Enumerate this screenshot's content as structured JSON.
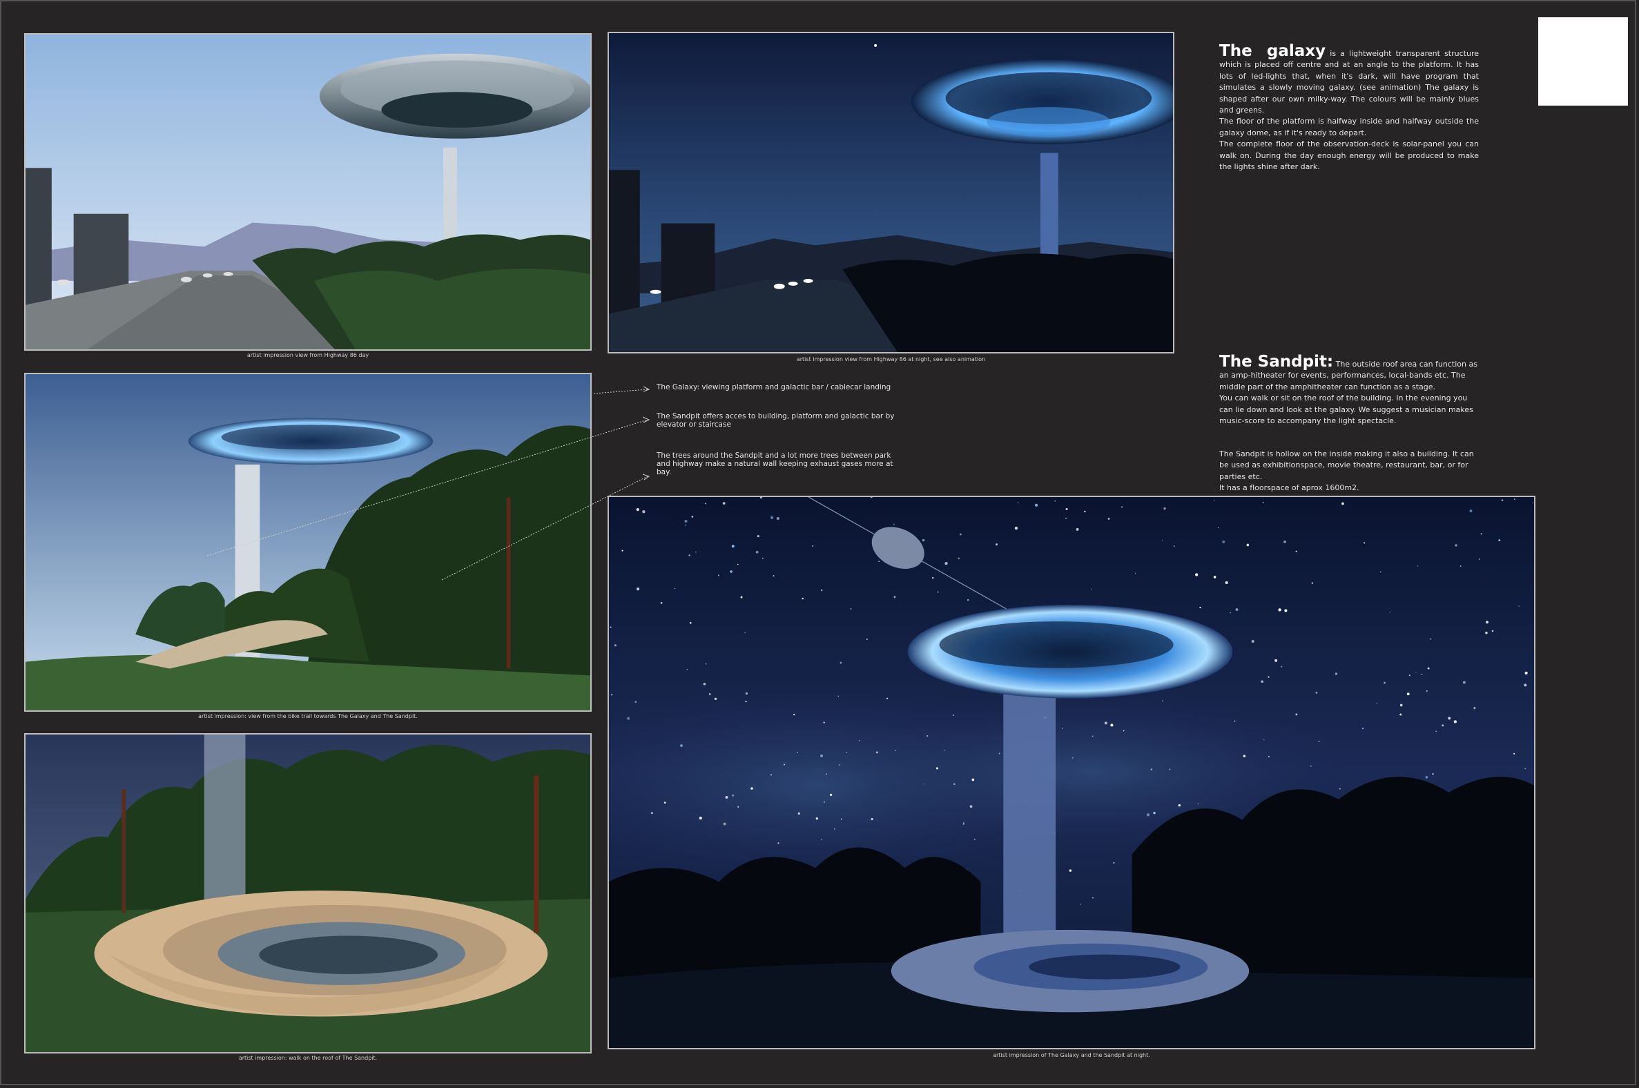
{
  "captions": {
    "highway_day": "artist impression view from Highway 86 day",
    "highway_night": "artist impression view from Highway 86 at night, see also animation",
    "bike_trail": "artist impression: view from the bike trail towards The Galaxy and The Sandpit.",
    "sandpit_roof": "artist impression: walk on the roof of The Sandpit.",
    "galaxy_sandpit_night": "artist impression of The Galaxy and the Sandpit at night."
  },
  "annotations": {
    "galaxy_note": "The Galaxy: viewing platform and galactic bar / cablecar landing",
    "sandpit_note": "The Sandpit offers acces to building, platform and galactic bar by elevator or staircase",
    "trees_note": "The trees around the Sandpit and a lot more trees between park and highway make a natural wall keeping exhaust gases more at bay."
  },
  "galaxy": {
    "heading": "The  galaxy",
    "intro": " is a lightweight transparent structure which is placed off centre and at an angle to the platform. It has lots of led-lights that,  when it's dark, will have program that simulates a  slowly moving galaxy. (see animation) The galaxy is shaped after our own milky-way. The colours will be mainly blues and greens.",
    "floor": "The floor of the platform is halfway inside and halfway outside the galaxy dome, as if it's ready to depart.",
    "solar": "The complete floor of the observation-deck is solar-panel you can walk on. During the day enough energy will be produced to make the lights shine after dark."
  },
  "sandpit": {
    "heading": "The Sandpit:",
    "intro": " The outside roof area can function as an amp-hitheater for events, performances, local-bands etc. The middle part of the amphitheater can function as a stage.",
    "roof": "You can walk or sit on the roof of the building.  In the evening you can lie down and look at the galaxy. We suggest a musician makes  music-score to accompany the light spectacle.",
    "hollow": "The Sandpit is hollow on the inside making it also a building. It can be used as exhibitionspace, movie theatre, restaurant, bar, or for parties etc.",
    "floorspace": "It has a floorspace of aprox 1600m2."
  },
  "colors": {
    "board_background": "#262425",
    "day_sky": "#b9d4ee",
    "night_sky": "#1b2a55",
    "galaxy_glow": "#5fb4ff",
    "tree_green": "#2d4f2a"
  }
}
